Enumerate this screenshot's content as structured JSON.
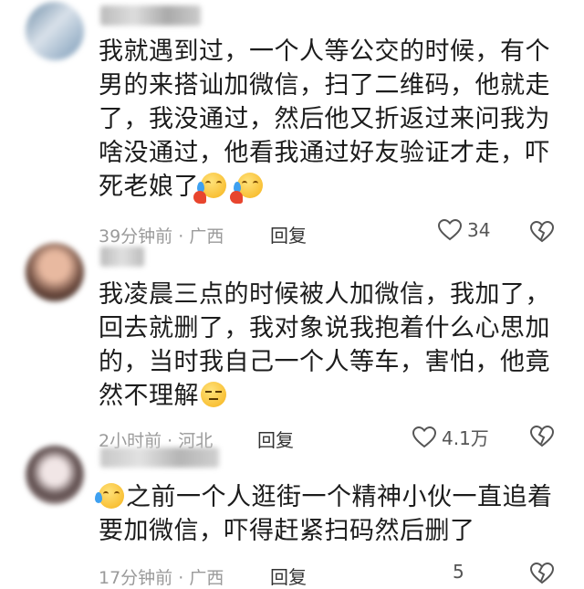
{
  "comments": [
    {
      "username": "• ■▓ ░ ▒",
      "lines": [
        "我就遇到过，一个人等公交的时候，有个",
        "男的来搭讪加微信，扫了二维码，他就走",
        "了，我没通过，然后他又折返过来问我为",
        "啥没通过，他看我通过好友验证才走，吓",
        "死老娘了"
      ],
      "time": "39分钟前",
      "location": "广西",
      "reply": "回复",
      "likes": "34",
      "emoji": [
        "crying-face-emoji",
        "crying-face-emoji"
      ]
    },
    {
      "username": "• ■",
      "lines": [
        "我凌晨三点的时候被人加微信，我加了，",
        "回去就删了，我对象说我抱着什么心思加",
        "的，当时我自己一个人等车，害怕，他竟",
        "然不理解"
      ],
      "time": "2小时前",
      "location": "河北",
      "reply": "回复",
      "likes": "4.1万",
      "emoji": [
        "unamused-face-emoji"
      ]
    },
    {
      "username": "• ▓ ■ ▒",
      "lines": [
        "之前一个人逛街一个精神小伙一直追着",
        "要加微信，吓得赶紧扫码然后删了"
      ],
      "time": "17分钟前",
      "location": "广西",
      "reply": "回复",
      "likes": "5",
      "emoji": [
        "crying-face-emoji"
      ]
    }
  ],
  "separator": "·",
  "colors": {
    "text": "#1c1c1c",
    "meta": "#9a9a9a",
    "icon": "#555555"
  }
}
